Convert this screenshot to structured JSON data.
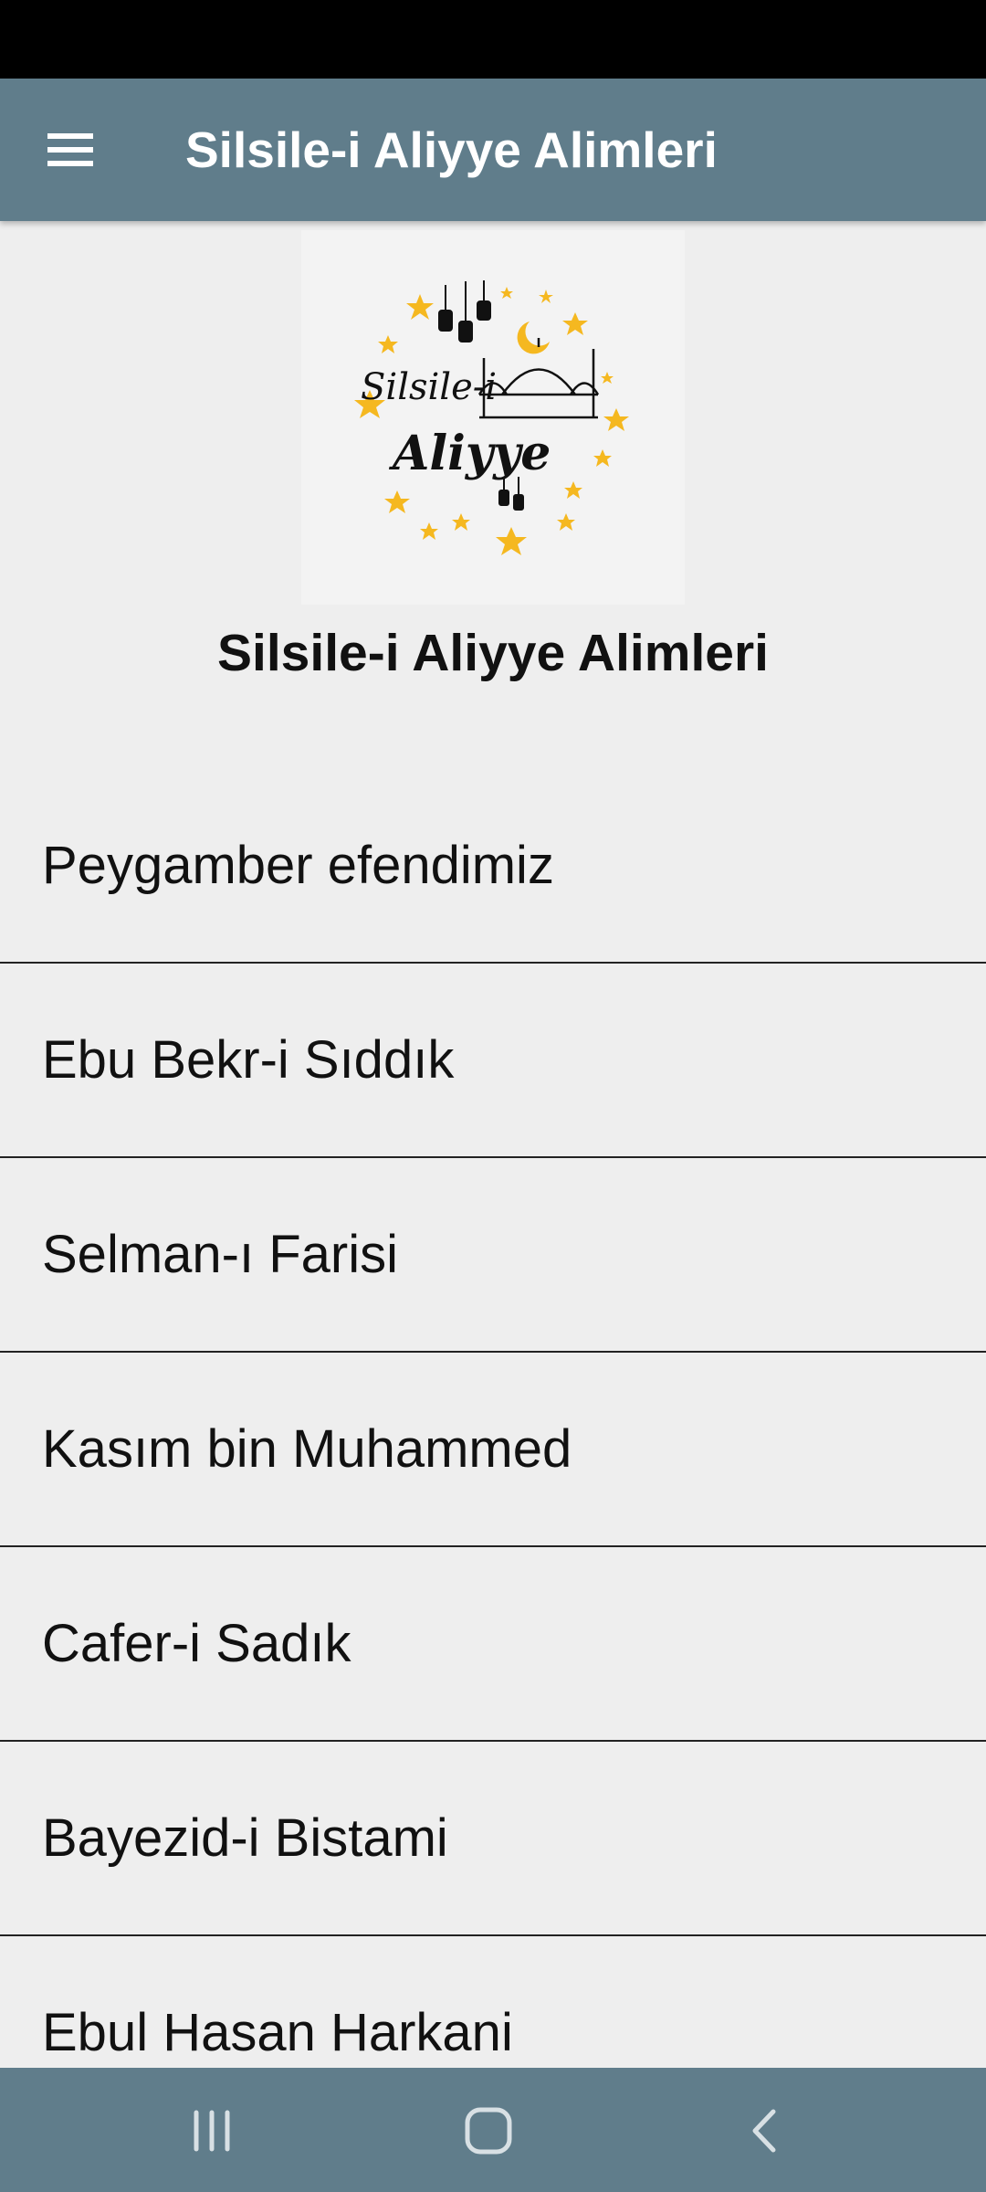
{
  "app_bar": {
    "title": "Silsile-i Aliyye Alimleri",
    "menu_icon": "hamburger-menu-icon"
  },
  "logo": {
    "line1": "Silsile-i",
    "line2": "Aliyye",
    "colors": {
      "stars": "#f5b820",
      "ink": "#111111"
    }
  },
  "heading": "Silsile-i Aliyye Alimleri",
  "list": {
    "items": [
      "Peygamber efendimiz",
      "Ebu Bekr-i Sıddık",
      "Selman-ı Farisi",
      "Kasım bin Muhammed",
      "Cafer-i Sadık",
      "Bayezid-i Bistami",
      "Ebul Hasan Harkani"
    ]
  },
  "nav_bar": {
    "recents_icon": "recent-apps-icon",
    "home_icon": "home-icon",
    "back_icon": "back-icon"
  },
  "colors": {
    "app_bar": "#607d8b",
    "nav_bar": "#607d8b",
    "background": "#eeeeee",
    "divider": "#222222"
  }
}
